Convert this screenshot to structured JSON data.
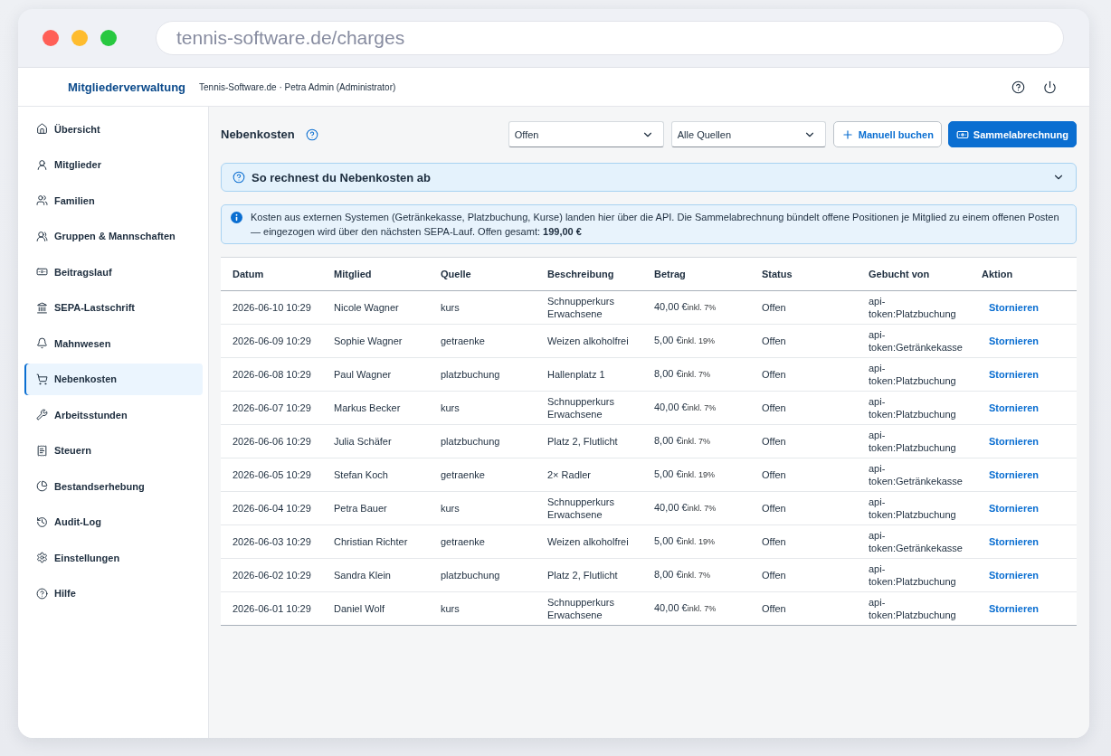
{
  "browser": {
    "url": "tennis-software.de/charges"
  },
  "header": {
    "app_title": "Mitgliederverwaltung",
    "context": "Tennis-Software.de · Petra Admin (Administrator)"
  },
  "sidebar": {
    "items": [
      {
        "label": "Übersicht",
        "selected": false
      },
      {
        "label": "Mitglieder",
        "selected": false
      },
      {
        "label": "Familien",
        "selected": false
      },
      {
        "label": "Gruppen & Mannschaften",
        "selected": false
      },
      {
        "label": "Beitragslauf",
        "selected": false
      },
      {
        "label": "SEPA-Lastschrift",
        "selected": false
      },
      {
        "label": "Mahnwesen",
        "selected": false
      },
      {
        "label": "Nebenkosten",
        "selected": true
      },
      {
        "label": "Arbeitsstunden",
        "selected": false
      },
      {
        "label": "Steuern",
        "selected": false
      },
      {
        "label": "Bestandserhebung",
        "selected": false
      },
      {
        "label": "Audit-Log",
        "selected": false
      },
      {
        "label": "Einstellungen",
        "selected": false
      },
      {
        "label": "Hilfe",
        "selected": false
      }
    ]
  },
  "page": {
    "title": "Nebenkosten",
    "filters": [
      {
        "value": "Offen"
      },
      {
        "value": "Alle Quellen"
      }
    ],
    "actions": [
      {
        "label": "Manuell buchen",
        "kind": "secondary"
      },
      {
        "label": "Sammelabrechnung",
        "kind": "primary"
      }
    ],
    "guide": {
      "title": "So rechnest du Nebenkosten ab",
      "expanded": false
    },
    "info": "Kosten aus externen Systemen (Getränkekasse, Platzbuchung, Kurse) landen hier über die API. Die Sammelabrechnung bündelt offene Positionen je Mitglied zu einem offenen Posten — eingezogen wird über den nächsten SEPA-Lauf. Offen gesamt: **199,00 €**",
    "table": {
      "columns": [
        "Datum",
        "Mitglied",
        "Quelle",
        "Beschreibung",
        "Betrag",
        "Status",
        "Gebucht von",
        "Aktion"
      ],
      "rows": [
        {
          "date": "2026-06-10 10:29",
          "member": "Nicole Wagner",
          "source": "kurs",
          "description": "Schnupperkurs Erwachsene",
          "amount": "40,00 €",
          "vat": "inkl. 7%",
          "status": "Offen",
          "booked_by": "api-token:Platzbuchung",
          "action": "Stornieren"
        },
        {
          "date": "2026-06-09 10:29",
          "member": "Sophie Wagner",
          "source": "getraenke",
          "description": "Weizen alkoholfrei",
          "amount": "5,00 €",
          "vat": "inkl. 19%",
          "status": "Offen",
          "booked_by": "api-token:Getränkekasse",
          "action": "Stornieren"
        },
        {
          "date": "2026-06-08 10:29",
          "member": "Paul Wagner",
          "source": "platzbuchung",
          "description": "Hallenplatz 1",
          "amount": "8,00 €",
          "vat": "inkl. 7%",
          "status": "Offen",
          "booked_by": "api-token:Platzbuchung",
          "action": "Stornieren"
        },
        {
          "date": "2026-06-07 10:29",
          "member": "Markus Becker",
          "source": "kurs",
          "description": "Schnupperkurs Erwachsene",
          "amount": "40,00 €",
          "vat": "inkl. 7%",
          "status": "Offen",
          "booked_by": "api-token:Platzbuchung",
          "action": "Stornieren"
        },
        {
          "date": "2026-06-06 10:29",
          "member": "Julia Schäfer",
          "source": "platzbuchung",
          "description": "Platz 2, Flutlicht",
          "amount": "8,00 €",
          "vat": "inkl. 7%",
          "status": "Offen",
          "booked_by": "api-token:Platzbuchung",
          "action": "Stornieren"
        },
        {
          "date": "2026-06-05 10:29",
          "member": "Stefan Koch",
          "source": "getraenke",
          "description": "2× Radler",
          "amount": "5,00 €",
          "vat": "inkl. 19%",
          "status": "Offen",
          "booked_by": "api-token:Getränkekasse",
          "action": "Stornieren"
        },
        {
          "date": "2026-06-04 10:29",
          "member": "Petra Bauer",
          "source": "kurs",
          "description": "Schnupperkurs Erwachsene",
          "amount": "40,00 €",
          "vat": "inkl. 7%",
          "status": "Offen",
          "booked_by": "api-token:Platzbuchung",
          "action": "Stornieren"
        },
        {
          "date": "2026-06-03 10:29",
          "member": "Christian Richter",
          "source": "getraenke",
          "description": "Weizen alkoholfrei",
          "amount": "5,00 €",
          "vat": "inkl. 19%",
          "status": "Offen",
          "booked_by": "api-token:Getränkekasse",
          "action": "Stornieren"
        },
        {
          "date": "2026-06-02 10:29",
          "member": "Sandra Klein",
          "source": "platzbuchung",
          "description": "Platz 2, Flutlicht",
          "amount": "8,00 €",
          "vat": "inkl. 7%",
          "status": "Offen",
          "booked_by": "api-token:Platzbuchung",
          "action": "Stornieren"
        },
        {
          "date": "2026-06-01 10:29",
          "member": "Daniel Wolf",
          "source": "kurs",
          "description": "Schnupperkurs Erwachsene",
          "amount": "40,00 €",
          "vat": "inkl. 7%",
          "status": "Offen",
          "booked_by": "api-token:Platzbuchung",
          "action": "Stornieren"
        }
      ]
    }
  }
}
